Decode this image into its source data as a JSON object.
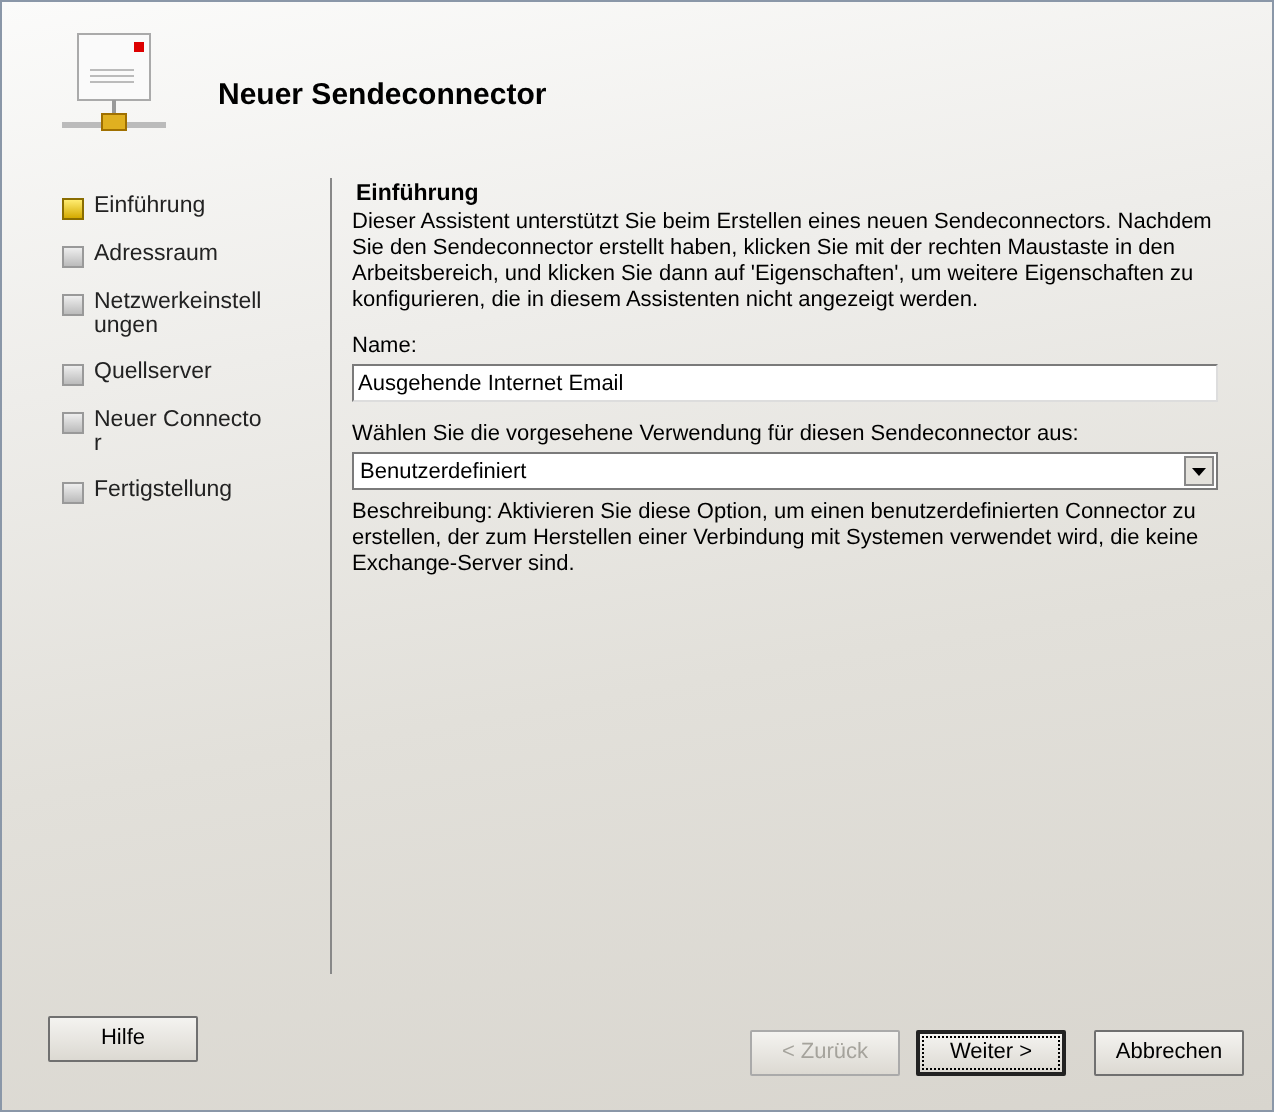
{
  "window": {
    "title": "Neuer Sendeconnector"
  },
  "steps": [
    {
      "label": "Einführung",
      "selected": true
    },
    {
      "label": "Adressraum",
      "selected": false
    },
    {
      "label": "Netzwerkeinstellungen",
      "selected": false
    },
    {
      "label": "Quellserver",
      "selected": false
    },
    {
      "label": "Neuer Connector",
      "selected": false
    },
    {
      "label": "Fertigstellung",
      "selected": false
    }
  ],
  "page": {
    "heading": "Einführung",
    "intro": "Dieser Assistent unterstützt Sie beim Erstellen eines neuen Sendeconnectors. Nachdem Sie den Sendeconnector erstellt haben, klicken Sie mit der rechten Maustaste in den Arbeitsbereich, und klicken Sie dann auf 'Eigenschaften', um weitere Eigenschaften zu konfigurieren, die in diesem Assistenten nicht angezeigt werden.",
    "name_label": "Name:",
    "name_value": "Ausgehende Internet Email",
    "use_label": "Wählen Sie die vorgesehene Verwendung für diesen Sendeconnector aus:",
    "use_value": "Benutzerdefiniert",
    "description": "Beschreibung: Aktivieren Sie diese Option, um einen benutzerdefinierten Connector zu erstellen, der zum Herstellen einer Verbindung mit Systemen verwendet wird, die keine Exchange-Server sind."
  },
  "buttons": [
    {
      "label": "Hilfe",
      "kind": "help",
      "disabled": false,
      "default": false
    },
    {
      "label": "< Zurück",
      "kind": "nav",
      "disabled": true,
      "default": false
    },
    {
      "label": "Weiter >",
      "kind": "nav",
      "disabled": false,
      "default": true
    },
    {
      "label": "Abbrechen",
      "kind": "cancel",
      "disabled": false,
      "default": false
    }
  ]
}
